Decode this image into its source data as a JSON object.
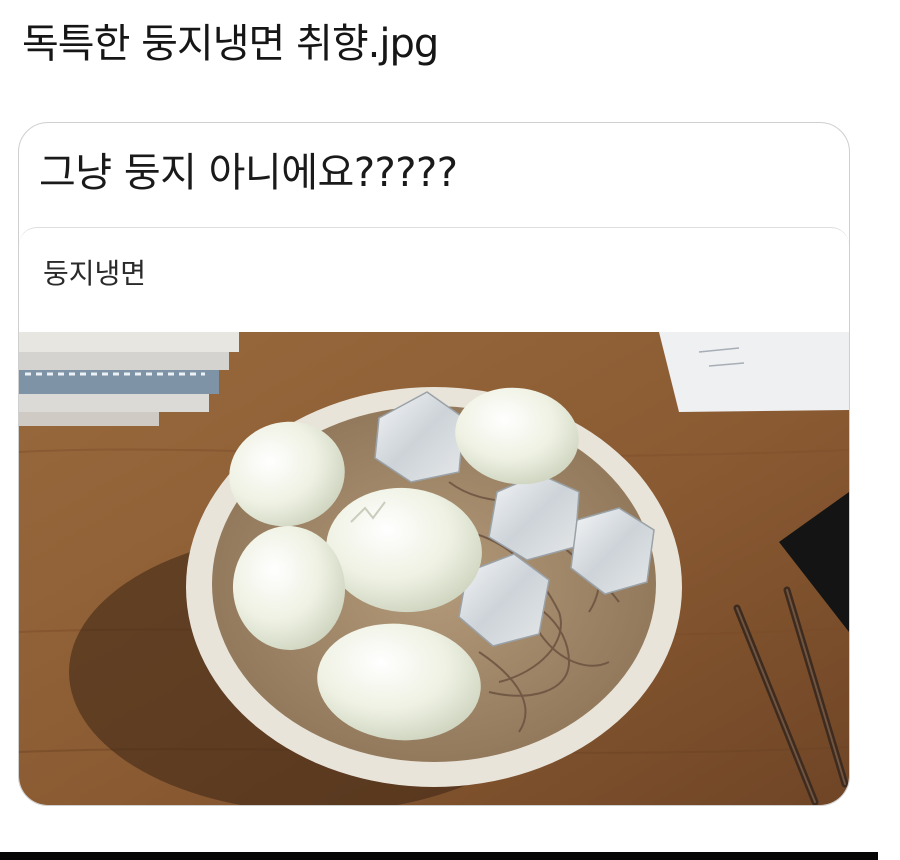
{
  "header": {
    "title": "독특한 둥지냉면 취향.jpg"
  },
  "post": {
    "text": "그냥 둥지 아니에요?????",
    "quote_label": "둥지냉면"
  },
  "photo": {
    "icon": "photo-naengmyeon-with-boiled-eggs-and-ice"
  },
  "colors": {
    "desk": "#8a5a33",
    "egg": "#f0f2e6",
    "bowl": "#e9e4da",
    "border": "#cfcfcf"
  }
}
